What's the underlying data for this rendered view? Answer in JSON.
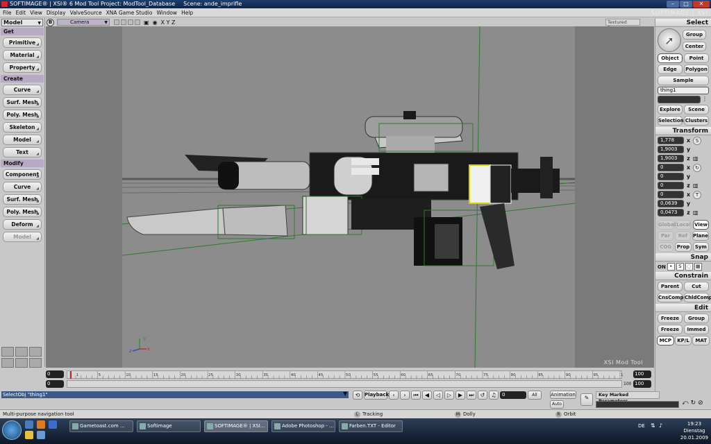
{
  "window": {
    "title": "SOFTIMAGE® | XSI® 6 Mod Tool Project: ModTool_Database",
    "scene": "Scene: ande_imprifle",
    "brand": "SOFTIMAGE | XSI"
  },
  "menu": [
    "File",
    "Edit",
    "View",
    "Display",
    "ValveSource",
    "XNA Game Studio",
    "Window",
    "Help"
  ],
  "left_panel": {
    "mode": "Model",
    "get_header": "Get",
    "get_items": [
      "Primitive",
      "Material",
      "Property"
    ],
    "create_header": "Create",
    "create_items": [
      "Curve",
      "Surf. Mesh",
      "Poly. Mesh",
      "Skeleton",
      "Model",
      "Text"
    ],
    "modify_header": "Modify",
    "modify_items": [
      "Component",
      "Curve",
      "Surf. Mesh",
      "Poly. Mesh",
      "Deform",
      "Model"
    ]
  },
  "viewport": {
    "b_label": "B",
    "camera": "Camera",
    "xyz": "X Y Z",
    "display_mode": "Textured Deco",
    "watermark": "XSI Mod Tool"
  },
  "right_panel": {
    "select_header": "Select",
    "group": "Group",
    "center": "Center",
    "object": "Object",
    "point": "Point",
    "edge": "Edge",
    "polygon": "Polygon",
    "sample": "Sample",
    "selection_name": "thing1",
    "explore": "Explore",
    "scene": "Scene",
    "selection": "Selection",
    "clusters": "Clusters",
    "transform_header": "Transform",
    "scale": [
      "1,778",
      "1,9003",
      "1,9003"
    ],
    "rotate": [
      "0",
      "0",
      "0"
    ],
    "translate": [
      "0",
      "0,0639",
      "0,0473"
    ],
    "axis_x": "x",
    "axis_y": "y",
    "axis_z": "z",
    "global": "Global",
    "local": "Local",
    "view": "View",
    "par": "Par",
    "ref": "Ref",
    "plane": "Plane",
    "cog": "COG",
    "prop": "Prop",
    "sym": "Sym",
    "snap_header": "Snap",
    "snap_on": "ON",
    "constrain_header": "Constrain",
    "parent": "Parent",
    "cut": "Cut",
    "cnscomp": "CnsComp",
    "chldcomp": "ChldComp",
    "edit_header": "Edit",
    "freeze": "Freeze",
    "edit_group": "Group",
    "freeze_m": "Freeze M",
    "immed": "Immed",
    "tab_mcp": "MCP",
    "tab_kpl": "KP/L",
    "tab_mat": "MAT"
  },
  "timeline": {
    "start": "0",
    "current": "0",
    "end_top": "100",
    "end_bottom": "100",
    "end_field": "100",
    "ticks": [
      "1",
      "5",
      "10",
      "15",
      "20",
      "25",
      "30",
      "35",
      "40",
      "45",
      "50",
      "55",
      "60",
      "65",
      "70",
      "75",
      "80",
      "85",
      "90",
      "95",
      "100"
    ]
  },
  "command": {
    "text": "SelectObj \"thing1\"",
    "playback": "Playback",
    "frame": "0",
    "all": "All",
    "animation": "Animation",
    "auto": "Auto",
    "key_marked": "Key Marked Parameters"
  },
  "status": {
    "hint": "Multi-purpose navigation tool",
    "l": "L",
    "l_action": "Tracking",
    "m": "M",
    "m_action": "Dolly",
    "r": "R",
    "r_action": "Orbit"
  },
  "taskbar": {
    "tasks": [
      "Gametoast.com ...",
      "Softimage",
      "SOFTIMAGE® | XSI...",
      "Adobe Photoshop - ...",
      "Farben.TXT - Editor"
    ],
    "lang": "DE",
    "time": "19:23",
    "day": "Dienstag",
    "date": "20.01.2009"
  }
}
